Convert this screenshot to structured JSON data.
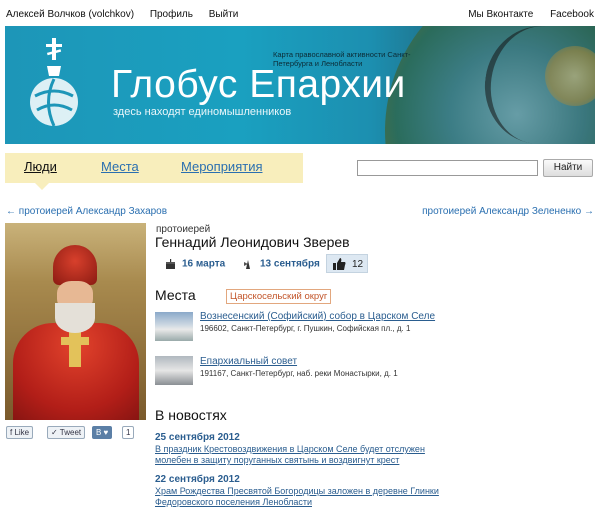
{
  "topbar": {
    "user": "Алексей Волчков (volchkov)",
    "profile": "Профиль",
    "logout": "Выйти",
    "vk": "Мы Вконтакте",
    "facebook": "Facebook"
  },
  "banner": {
    "subtitle": "Карта православной активности Санкт-Петербурга и Ленобласти",
    "title": "Глобус Епархии",
    "tagline": "здесь находят единомышленников"
  },
  "nav": {
    "tabs": [
      "Люди",
      "Места",
      "Мероприятия"
    ],
    "active": "Люди"
  },
  "search": {
    "value": "",
    "button": "Найти"
  },
  "pager": {
    "prev": "← протоиерей Александр Захаров",
    "next": "протоиерей Александр Зелененко →"
  },
  "social": {
    "fb": "Like",
    "tw": "Tweet",
    "vk": "В ♥",
    "count": "1"
  },
  "person": {
    "role": "протоиерей",
    "name": "Геннадий Леонидович Зверев",
    "date_birth": "16 марта",
    "date_name": "13 сентября",
    "likes": "12"
  },
  "places": {
    "heading": "Места",
    "district": "Царскосельский округ",
    "items": [
      {
        "name": "Вознесенский (Софийский) собор в Царском Селе",
        "address": "196602, Санкт-Петербург, г. Пушкин, Софийская пл., д. 1"
      },
      {
        "name": "Епархиальный совет",
        "address": "191167, Санкт-Петербург, наб. реки Монастырки, д. 1"
      }
    ]
  },
  "news": {
    "heading": "В новостях",
    "items": [
      {
        "date": "25 сентября 2012",
        "title": "В праздник Крестовоздвижения в Царском Селе будет отслужен молебен в защиту поруганных святынь и воздвигнут крест"
      },
      {
        "date": "22 сентября 2012",
        "title": "Храм Рождества Пресвятой Богородицы заложен в деревне Глинки Федоровского поселения Ленобласти"
      }
    ]
  },
  "colors": {
    "link": "#2a5d8f",
    "nav_bg": "#f8eebc",
    "banner": "#1d96b8",
    "tag": "#c2552a"
  }
}
